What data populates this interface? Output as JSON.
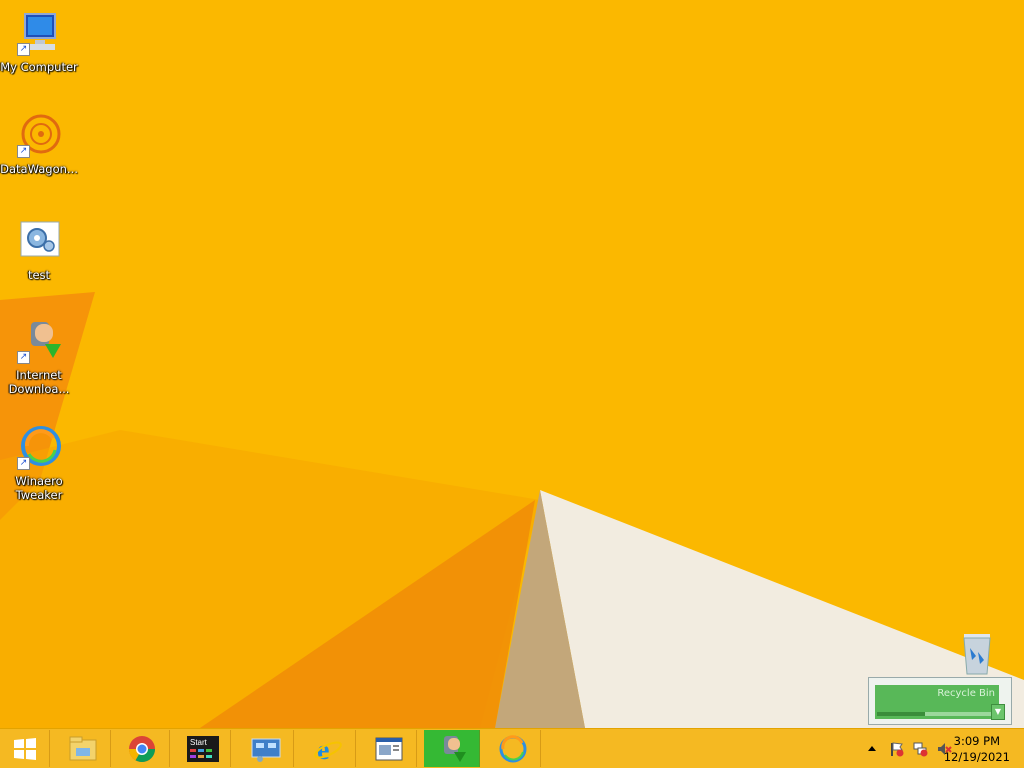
{
  "desktop": {
    "background_color": "#fbb800",
    "icons": [
      {
        "label": "My Computer",
        "icon": "computer-icon",
        "shortcut": true
      },
      {
        "label": "DataWagon...",
        "icon": "datawagon-icon",
        "shortcut": true
      },
      {
        "label": "test",
        "icon": "settings-file-icon",
        "shortcut": false
      },
      {
        "label": "Internet Downloa...",
        "icon": "internet-download-manager-icon",
        "shortcut": true
      },
      {
        "label": "Winaero Tweaker",
        "icon": "winaero-tweaker-icon",
        "shortcut": true
      }
    ],
    "recycle_bin": {
      "label": "Recycle Bin",
      "icon": "recycle-bin-icon"
    }
  },
  "idm_widget": {
    "title": "Recycle Bin"
  },
  "taskbar": {
    "buttons": [
      {
        "name": "start-button",
        "icon": "windows-logo-icon"
      },
      {
        "name": "file-explorer-button",
        "icon": "file-explorer-icon"
      },
      {
        "name": "chrome-button",
        "icon": "chrome-icon"
      },
      {
        "name": "start-screen-button",
        "icon": "start-screen-icon",
        "label": "Start"
      },
      {
        "name": "control-panel-button",
        "icon": "control-panel-icon"
      },
      {
        "name": "internet-explorer-button",
        "icon": "internet-explorer-icon"
      },
      {
        "name": "window-app-button",
        "icon": "window-app-icon"
      },
      {
        "name": "internet-download-manager-button",
        "icon": "internet-download-manager-icon",
        "active": true
      },
      {
        "name": "winaero-tweaker-button",
        "icon": "winaero-tweaker-icon"
      }
    ],
    "accent_active": "#35b934",
    "tray": {
      "icons": [
        "show-hidden-icons-arrow",
        "action-center-flag-icon",
        "network-icon",
        "volume-muted-icon"
      ],
      "time": "3:09 PM",
      "date": "12/19/2021"
    }
  }
}
